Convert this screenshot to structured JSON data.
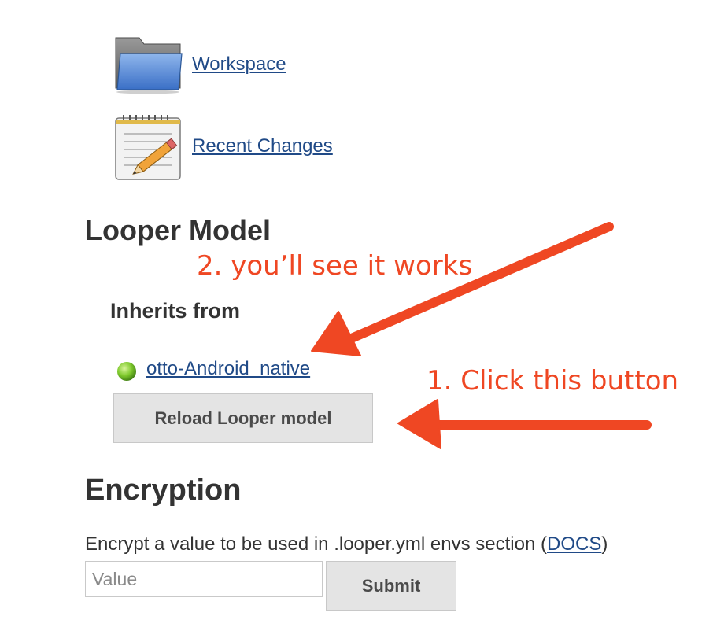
{
  "tasks": [
    {
      "label": "Workspace",
      "icon": "folder-icon"
    },
    {
      "label": "Recent Changes",
      "icon": "notepad-pencil-icon"
    }
  ],
  "looper": {
    "title": "Looper Model",
    "inherits_title": "Inherits from",
    "parent_job": "otto-Android_native",
    "status_color": "#7ec92c",
    "reload_button": "Reload Looper model"
  },
  "encryption": {
    "title": "Encryption",
    "description_prefix": "Encrypt a value to be used in .looper.yml envs section (",
    "docs_link": "DOCS",
    "description_suffix": ")",
    "value_placeholder": "Value",
    "value": "",
    "submit_button": "Submit"
  },
  "annotations": {
    "step2": "2. you’ll see it works",
    "step1": "1. Click this button",
    "color": "#ef4723"
  }
}
